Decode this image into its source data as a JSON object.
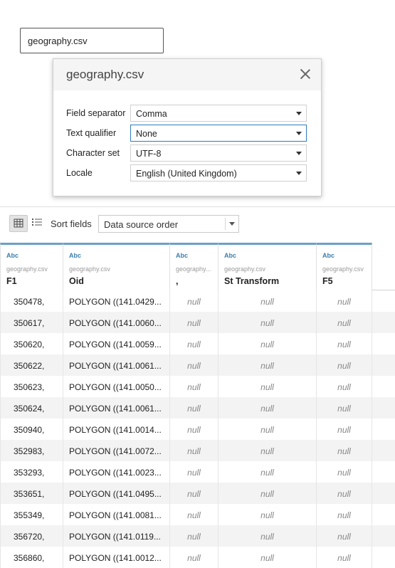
{
  "file_chip": {
    "label": "geography.csv"
  },
  "dialog": {
    "title": "geography.csv",
    "fields": [
      {
        "label": "Field separator",
        "value": "Comma"
      },
      {
        "label": "Text qualifier",
        "value": "None"
      },
      {
        "label": "Character set",
        "value": "UTF-8"
      },
      {
        "label": "Locale",
        "value": "English (United Kingdom)"
      }
    ]
  },
  "toolbar": {
    "sort_label": "Sort fields",
    "sort_value": "Data source order"
  },
  "columns": [
    {
      "type": "Abc",
      "source": "geography.csv",
      "name": "F1"
    },
    {
      "type": "Abc",
      "source": "geography.csv",
      "name": "Oid"
    },
    {
      "type": "Abc",
      "source": "geography...",
      "name": ","
    },
    {
      "type": "Abc",
      "source": "geography.csv",
      "name": "St Transform"
    },
    {
      "type": "Abc",
      "source": "geography.csv",
      "name": "F5"
    }
  ],
  "rows": [
    [
      "350478,",
      "POLYGON ((141.0429...",
      "null",
      "null",
      "null"
    ],
    [
      "350617,",
      "POLYGON ((141.0060...",
      "null",
      "null",
      "null"
    ],
    [
      "350620,",
      "POLYGON ((141.0059...",
      "null",
      "null",
      "null"
    ],
    [
      "350622,",
      "POLYGON ((141.0061...",
      "null",
      "null",
      "null"
    ],
    [
      "350623,",
      "POLYGON ((141.0050...",
      "null",
      "null",
      "null"
    ],
    [
      "350624,",
      "POLYGON ((141.0061...",
      "null",
      "null",
      "null"
    ],
    [
      "350940,",
      "POLYGON ((141.0014...",
      "null",
      "null",
      "null"
    ],
    [
      "352983,",
      "POLYGON ((141.0072...",
      "null",
      "null",
      "null"
    ],
    [
      "353293,",
      "POLYGON ((141.0023...",
      "null",
      "null",
      "null"
    ],
    [
      "353651,",
      "POLYGON ((141.0495...",
      "null",
      "null",
      "null"
    ],
    [
      "355349,",
      "POLYGON ((141.0081...",
      "null",
      "null",
      "null"
    ],
    [
      "356720,",
      "POLYGON ((141.0119...",
      "null",
      "null",
      "null"
    ],
    [
      "356860,",
      "POLYGON ((141.0012...",
      "null",
      "null",
      "null"
    ]
  ],
  "icons": {
    "close": "close-icon",
    "grid_view": "grid-view-icon",
    "list_view": "list-view-icon",
    "dropdown": "chevron-down-icon"
  },
  "colors": {
    "accent": "#2f7bbf",
    "header_top": "#6aa1c4",
    "type_label": "#3b7eae"
  }
}
